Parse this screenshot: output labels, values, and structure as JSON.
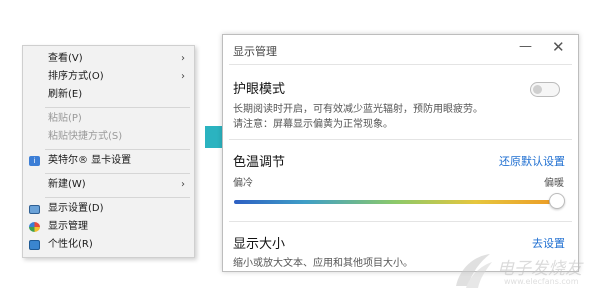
{
  "context_menu": {
    "items": [
      {
        "label": "查看(V)",
        "submenu": true,
        "enabled": true
      },
      {
        "label": "排序方式(O)",
        "submenu": true,
        "enabled": true
      },
      {
        "label": "刷新(E)",
        "submenu": false,
        "enabled": true
      },
      {
        "label": "粘贴(P)",
        "submenu": false,
        "enabled": false
      },
      {
        "label": "粘贴快捷方式(S)",
        "submenu": false,
        "enabled": false
      },
      {
        "label": "英特尔® 显卡设置",
        "submenu": false,
        "enabled": true,
        "icon": "intel-graphics-icon"
      },
      {
        "label": "新建(W)",
        "submenu": true,
        "enabled": true
      },
      {
        "label": "显示设置(D)",
        "submenu": false,
        "enabled": true,
        "icon": "display-settings-icon"
      },
      {
        "label": "显示管理",
        "submenu": false,
        "enabled": true,
        "icon": "display-manager-icon"
      },
      {
        "label": "个性化(R)",
        "submenu": false,
        "enabled": true,
        "icon": "personalize-icon"
      }
    ],
    "chevron": "›"
  },
  "arrow_color": "#2bb3c0",
  "window": {
    "title": "显示管理",
    "minimize_glyph": "—",
    "close_glyph": "✕",
    "eye_care": {
      "heading": "护眼模式",
      "desc_line1": "长期阅读时开启，可有效减少蓝光辐射，预防用眼疲劳。",
      "desc_line2": "请注意：屏幕显示偏黄为正常现象。",
      "toggle_on": false
    },
    "color_temp": {
      "heading": "色温调节",
      "reset_link": "还原默认设置",
      "left_label": "偏冷",
      "right_label": "偏暖",
      "slider_value": 1.0
    },
    "display_size": {
      "heading": "显示大小",
      "link": "去设置",
      "desc": "缩小或放大文本、应用和其他项目大小。"
    }
  },
  "watermark": {
    "text_cn": "电子发烧友",
    "text_en": "www.elecfans.com"
  }
}
